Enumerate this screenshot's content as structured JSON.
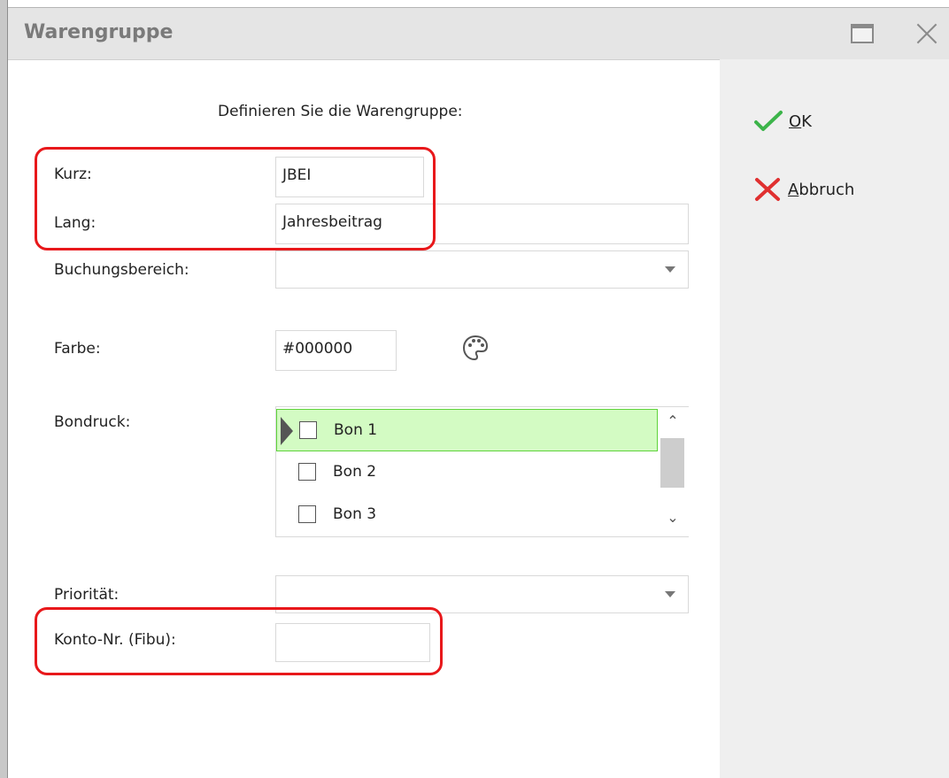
{
  "window": {
    "title": "Warengruppe"
  },
  "heading": "Definieren Sie die Warengruppe:",
  "fields": {
    "kurz": {
      "label": "Kurz:",
      "value": "JBEI"
    },
    "lang": {
      "label": "Lang:",
      "value": "Jahresbeitrag"
    },
    "buchungsbereich": {
      "label": "Buchungsbereich:",
      "value": ""
    },
    "farbe": {
      "label": "Farbe:",
      "value": "#000000"
    },
    "bondruck": {
      "label": "Bondruck:"
    },
    "prioritaet": {
      "label": "Priorität:",
      "value": ""
    },
    "konto": {
      "label": "Konto-Nr. (Fibu):",
      "value": ""
    }
  },
  "bondruck_items": [
    {
      "label": "Bon 1",
      "checked": false,
      "selected": true
    },
    {
      "label": "Bon 2",
      "checked": false,
      "selected": false
    },
    {
      "label": "Bon 3",
      "checked": false,
      "selected": false
    }
  ],
  "actions": {
    "ok": "OK",
    "cancel": "Abbruch"
  },
  "colors": {
    "highlight": "#e8181b",
    "ok_icon": "#3cb44a",
    "cancel_icon": "#e03030",
    "selected_row": "#d3fbc3"
  },
  "icons": {
    "maximize": "maximize-icon",
    "close": "close-icon",
    "palette": "palette-icon",
    "ok": "checkmark-icon",
    "cancel": "x-icon"
  }
}
